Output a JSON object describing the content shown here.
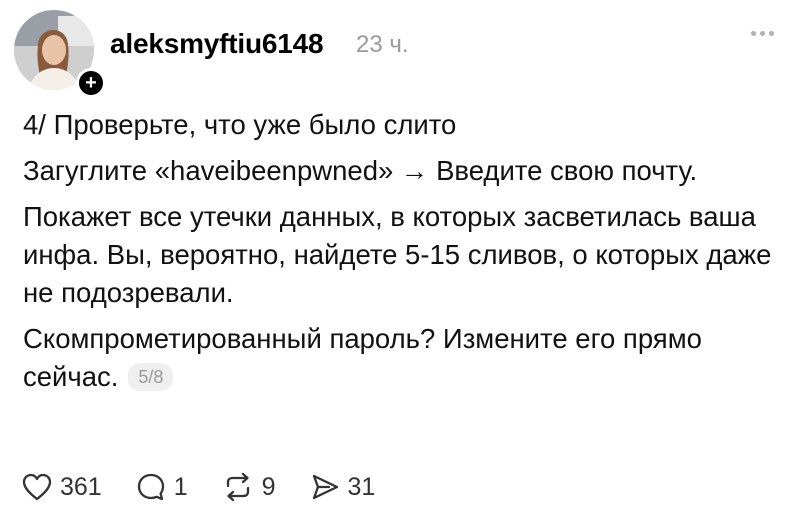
{
  "post": {
    "author": "aleksmyftiu6148",
    "time": "23 ч.",
    "follow_symbol": "+",
    "paragraphs": [
      "4/ Проверьте, что уже было слито",
      "Загуглите «haveibeenpwned» → Введите свою почту.",
      "Покажет все утечки данных, в которых засветилась ваша инфа. Вы, вероятно, найдете 5-15 сливов, о которых даже не подозревали."
    ],
    "last_paragraph": "Скомпрометированный пароль? Измените его прямо сейчас.",
    "counter": "5/8"
  },
  "actions": {
    "likes": "361",
    "replies": "1",
    "reposts": "9",
    "shares": "31"
  },
  "icons": {
    "like": "heart-icon",
    "reply": "comment-icon",
    "repost": "repost-icon",
    "share": "send-icon",
    "more": "more-icon"
  },
  "colors": {
    "text": "#111111",
    "muted": "#9a9a9a",
    "badge": "#000000"
  }
}
